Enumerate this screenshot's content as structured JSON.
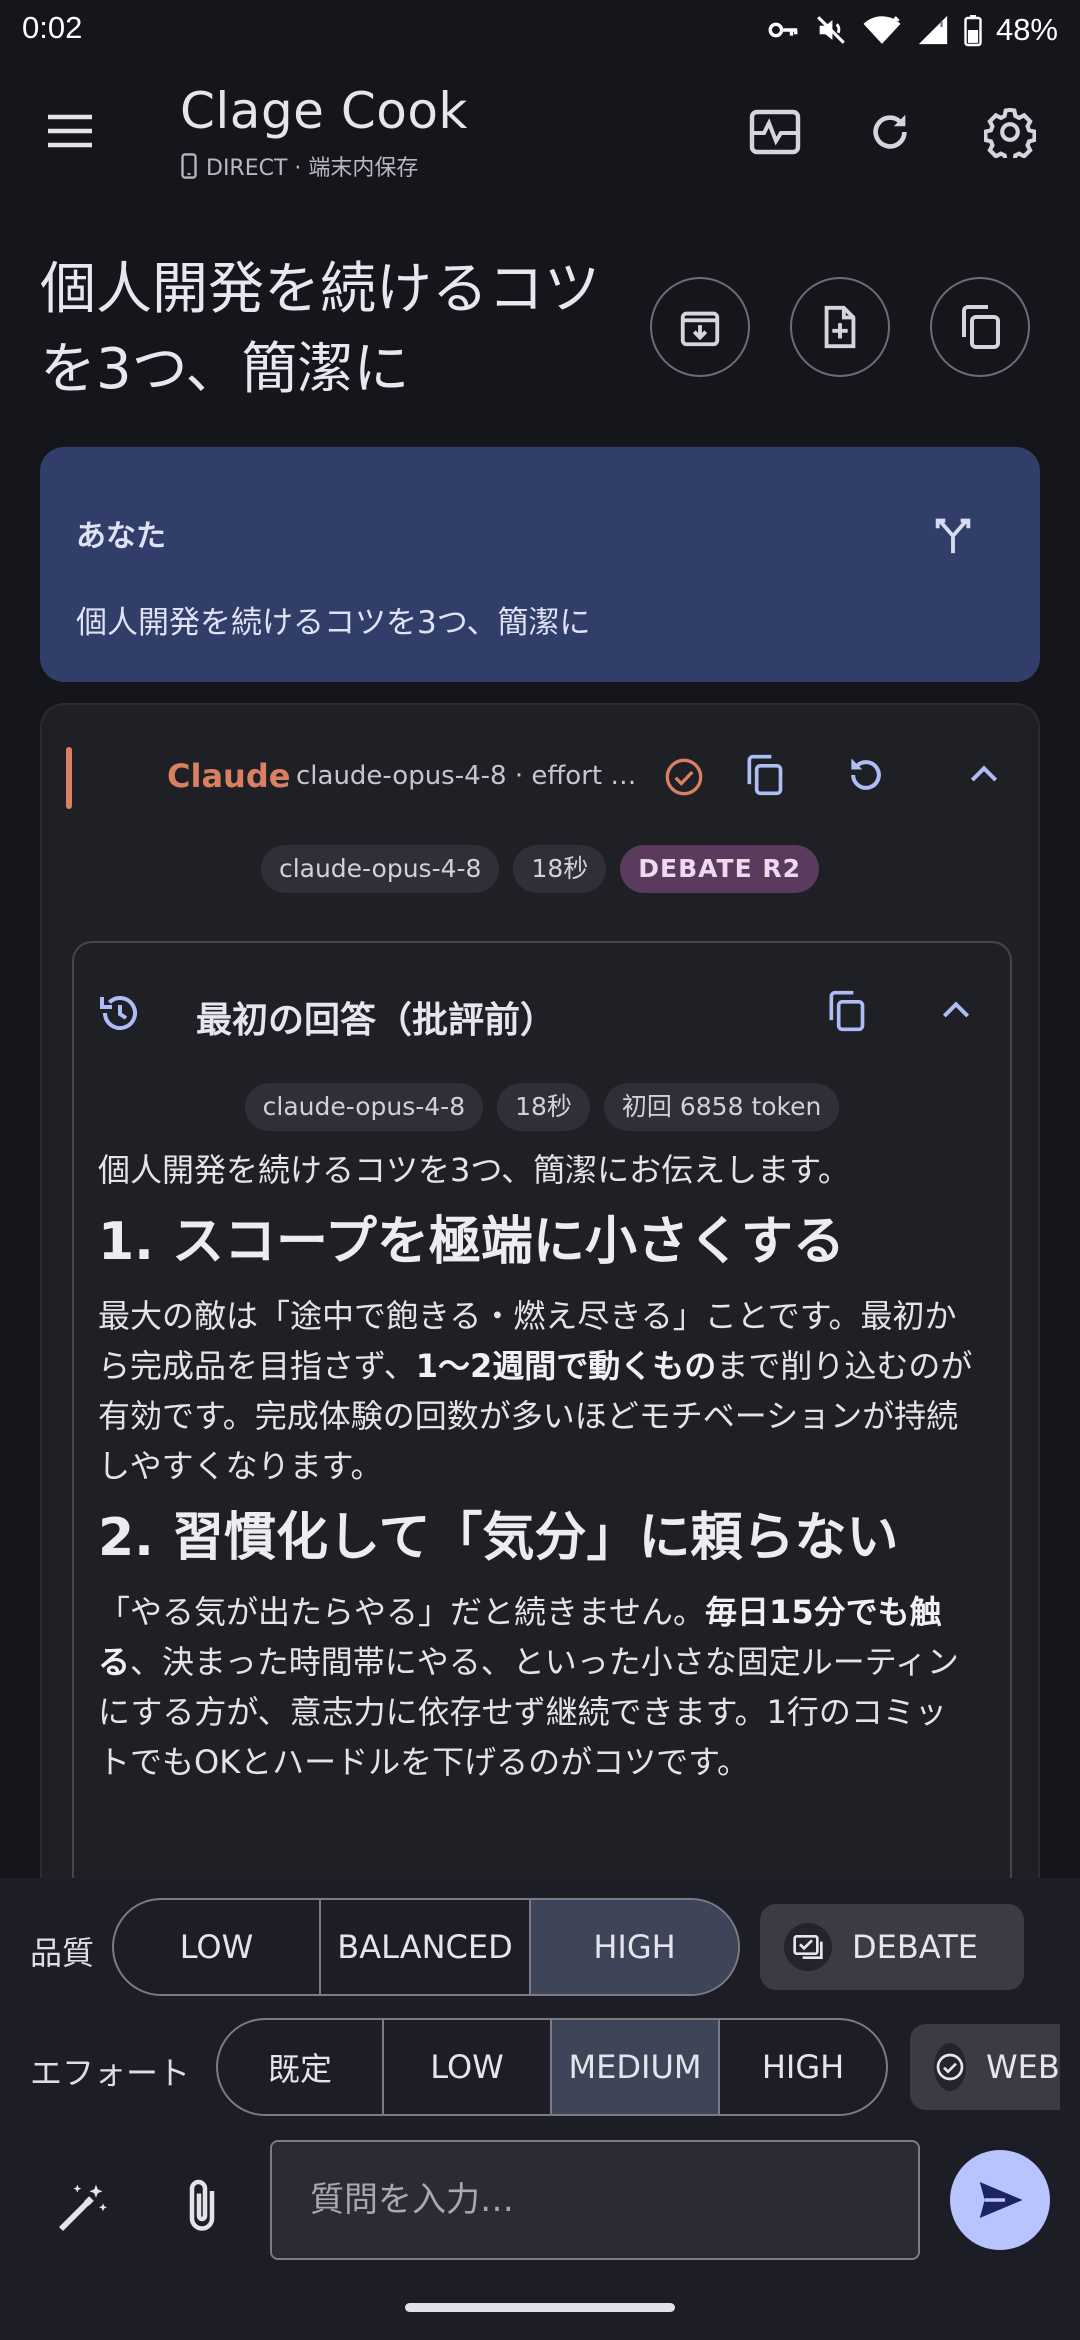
{
  "status_bar": {
    "time": "0:02",
    "battery": "48%"
  },
  "app_bar": {
    "title": "Clage Cook",
    "subtitle": "DIRECT · 端末内保存",
    "icons": [
      "menu-icon",
      "activity-icon",
      "refresh-icon",
      "settings-icon"
    ]
  },
  "conversation": {
    "title": "個人開発を続けるコツを3つ、簡潔に",
    "actions": [
      "archive-icon",
      "new-document-icon",
      "copy-icon"
    ]
  },
  "user_message": {
    "label": "あなた",
    "text": "個人開発を続けるコツを3つ、簡潔に"
  },
  "assistant": {
    "name": "Claude",
    "model_effort": "claude-opus-4-8 · effort …",
    "chips": [
      "claude-opus-4-8",
      "18秒",
      "DEBATE R2"
    ],
    "colors": {
      "accent": "#d98063"
    },
    "initial_answer": {
      "title": "最初の回答（批評前）",
      "chips": [
        "claude-opus-4-8",
        "18秒",
        "初回 6858 token"
      ],
      "intro": "個人開発を続けるコツを3つ、簡潔にお伝えします。",
      "h1": "1. スコープを極端に小さくする",
      "p1_a": "最大の敵は「途中で飽きる・燃え尽きる」ことです。最初から完成品を目指さず、",
      "p1_bold": "1〜2週間で動くもの",
      "p1_b": "まで削り込むのが有効です。完成体験の回数が多いほどモチベーションが持続しやすくなります。",
      "h2": "2. 習慣化して「気分」に頼らない",
      "p2_a": "「やる気が出たらやる」だと続きません。",
      "p2_bold": "毎日15分でも触る",
      "p2_b": "、決まった時間帯にやる、といった小さな固定ルーティンにする方が、意志力に依存せず継続できます。1行のコミットでもOKとハードルを下げるのがコツです。"
    }
  },
  "controls": {
    "quality_label": "品質",
    "quality_options": [
      "LOW",
      "BALANCED",
      "HIGH"
    ],
    "quality_selected": "HIGH",
    "debate_label": "DEBATE",
    "effort_label": "エフォート",
    "effort_options": [
      "既定",
      "LOW",
      "MEDIUM",
      "HIGH"
    ],
    "effort_selected": "MEDIUM",
    "web_label": "WEB"
  },
  "composer": {
    "placeholder": "質問を入力…"
  }
}
